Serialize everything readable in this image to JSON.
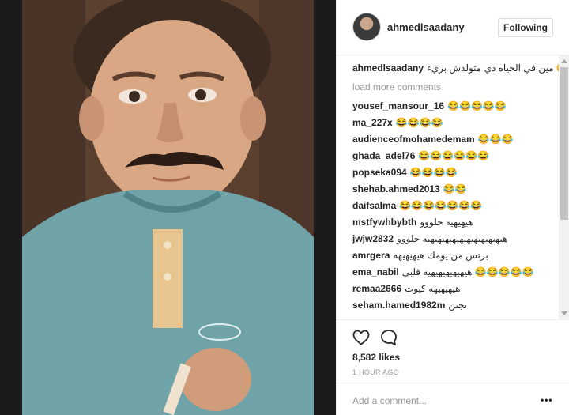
{
  "post": {
    "image_alt": "Photo of a young boy with a mustache",
    "owner": "ahmedlsaadany",
    "follow_label": "Following"
  },
  "caption": {
    "user": "ahmedlsaadany",
    "text": "مين في الحياه دي متولدش بريء 😊"
  },
  "load_more": "load more comments",
  "comments": [
    {
      "user": "yousef_mansour_16",
      "text": "😂😂😂😂😂"
    },
    {
      "user": "ma_227x",
      "text": "😂😂😂😂"
    },
    {
      "user": "audienceofmohamedemam",
      "text": "😂😂😂"
    },
    {
      "user": "ghada_adel76",
      "text": "😂😂😂😂😂😂"
    },
    {
      "user": "popseka094",
      "text": "😂😂😂😂"
    },
    {
      "user": "shehab.ahmed2013",
      "text": "😂😂"
    },
    {
      "user": "daifsalma",
      "text": "😂😂😂😂😂😂😂"
    },
    {
      "user": "mstfywhbybth",
      "text": "هيهيهيه حلووو"
    },
    {
      "user": "jwjw2832",
      "text": "هيهيهيهيهيهيهيهيهيهيهيه حلووو"
    },
    {
      "user": "amrgera",
      "text": "برنس من يومك هيهيهيهه"
    },
    {
      "user": "ema_nabil",
      "text": "هيهيهيهيهيهيه قلبي 😂😂😂😂😂"
    },
    {
      "user": "remaa2666",
      "text": "هيهيهيهه كيوت"
    },
    {
      "user": "seham.hamed1982m",
      "text": "تجنن"
    }
  ],
  "icons": {
    "like": "heart-icon",
    "comment": "speech-bubble-icon",
    "options": "ellipsis-icon"
  },
  "likes": "8,582 likes",
  "time_ago": "1 HOUR AGO",
  "add_comment_placeholder": "Add a comment...",
  "options_label": "•••",
  "colors": {
    "text": "#262626",
    "muted": "#999999",
    "border": "#efefef"
  }
}
